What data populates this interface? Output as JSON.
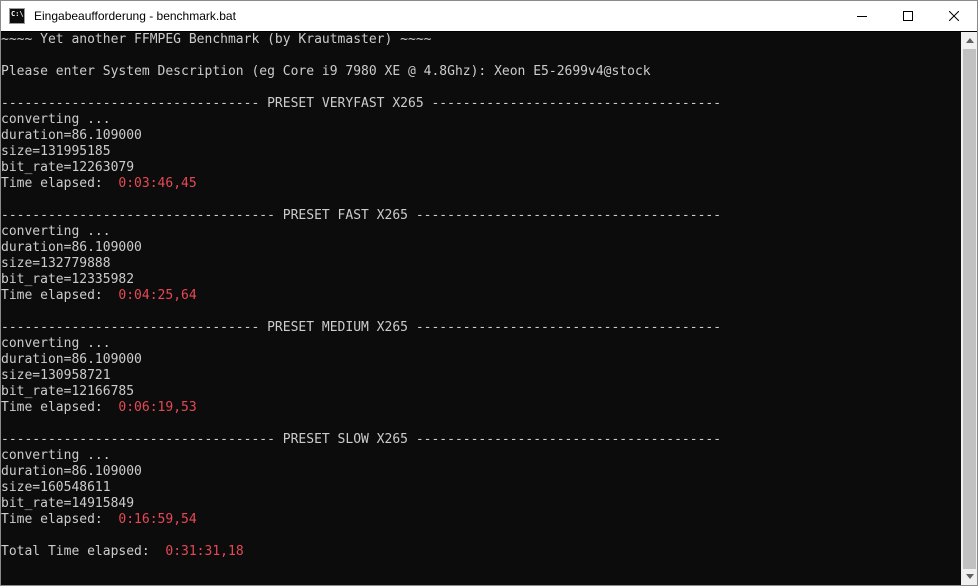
{
  "window": {
    "title": "Eingabeaufforderung - benchmark.bat",
    "icon": "cmd-icon",
    "icon_glyph": "C:\\",
    "controls": [
      "minimize-icon",
      "maximize-icon",
      "close-icon"
    ]
  },
  "colors": {
    "background": "#0c0c0c",
    "text": "#cccccc",
    "highlight": "#e74856"
  },
  "terminal": {
    "lines": [
      {
        "text": "~~~~ Yet another FFMPEG Benchmark (by Krautmaster) ~~~~"
      },
      {
        "text": ""
      },
      {
        "text": "Please enter System Description (eg Core i9 7980 XE @ 4.8Ghz): Xeon E5-2699v4@stock"
      },
      {
        "text": ""
      },
      {
        "text": "--------------------------------- PRESET VERYFAST X265 -------------------------------------"
      },
      {
        "text": "converting ..."
      },
      {
        "text": "duration=86.109000"
      },
      {
        "text": "size=131995185"
      },
      {
        "text": "bit_rate=12263079"
      },
      {
        "text": "Time elapsed:  ",
        "value": "0:03:46,45"
      },
      {
        "text": ""
      },
      {
        "text": "----------------------------------- PRESET FAST X265 ---------------------------------------"
      },
      {
        "text": "converting ..."
      },
      {
        "text": "duration=86.109000"
      },
      {
        "text": "size=132779888"
      },
      {
        "text": "bit_rate=12335982"
      },
      {
        "text": "Time elapsed:  ",
        "value": "0:04:25,64"
      },
      {
        "text": ""
      },
      {
        "text": "--------------------------------- PRESET MEDIUM X265 ---------------------------------------"
      },
      {
        "text": "converting ..."
      },
      {
        "text": "duration=86.109000"
      },
      {
        "text": "size=130958721"
      },
      {
        "text": "bit_rate=12166785"
      },
      {
        "text": "Time elapsed:  ",
        "value": "0:06:19,53"
      },
      {
        "text": ""
      },
      {
        "text": "----------------------------------- PRESET SLOW X265 ---------------------------------------"
      },
      {
        "text": "converting ..."
      },
      {
        "text": "duration=86.109000"
      },
      {
        "text": "size=160548611"
      },
      {
        "text": "bit_rate=14915849"
      },
      {
        "text": "Time elapsed:  ",
        "value": "0:16:59,54"
      },
      {
        "text": ""
      },
      {
        "text": "Total Time elapsed:  ",
        "value": "0:31:31,18"
      }
    ]
  }
}
